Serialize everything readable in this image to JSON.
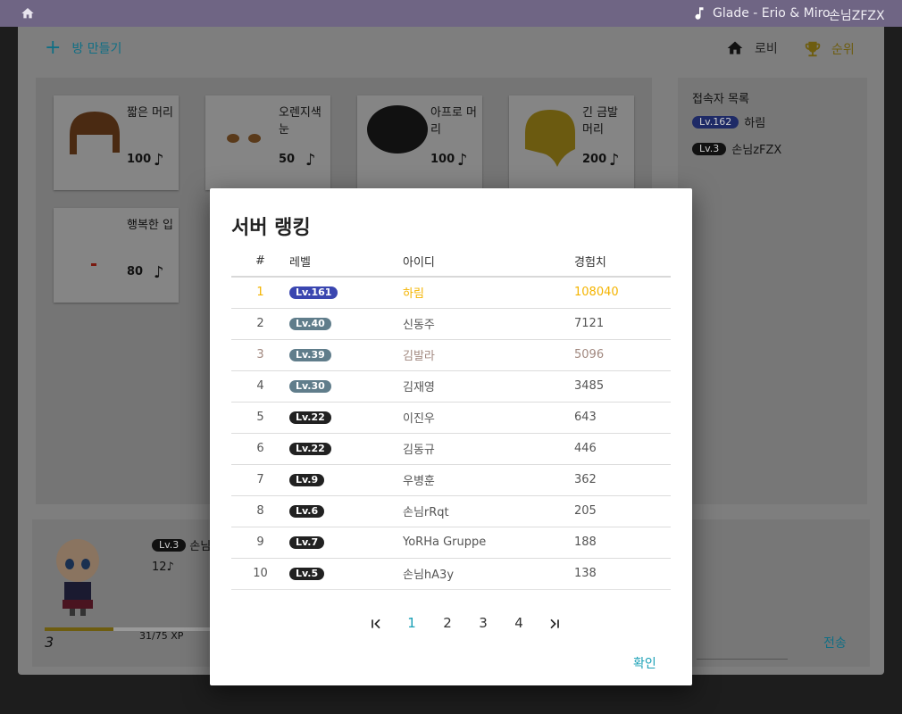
{
  "topbar": {
    "now_playing": "Glade - Erio & Miro",
    "username": "손님ZFZX"
  },
  "toolbar": {
    "new_room": "방 만들기",
    "lobby": "로비",
    "ranking": "순위"
  },
  "shop": {
    "items": [
      {
        "name": "짧은 머리",
        "price": "100"
      },
      {
        "name": "오렌지색 눈",
        "price": "50"
      },
      {
        "name": "아프로 머리",
        "price": "100"
      },
      {
        "name": "긴 금발 머리",
        "price": "200"
      },
      {
        "name": "행복한 입",
        "price": "80"
      }
    ]
  },
  "online": {
    "title": "접속자 목록",
    "users": [
      {
        "level": "Lv.162",
        "name": "하림"
      },
      {
        "level": "Lv.3",
        "name": "손님zFZX"
      }
    ]
  },
  "profile": {
    "level_badge": "Lv.3",
    "name": "손님",
    "notes": "12",
    "level": "3",
    "xp_text": "31/75 XP",
    "xp_progress": 0.413
  },
  "chat": {
    "send": "전송"
  },
  "dialog": {
    "title": "서버 랭킹",
    "columns": {
      "rank": "#",
      "level": "레벨",
      "id": "아이디",
      "xp": "경험치"
    },
    "rows": [
      {
        "rank": "1",
        "level": "Lv.161",
        "id": "하림",
        "xp": "108040",
        "badge_color": "#3a46b0",
        "text_color": "#f4b400"
      },
      {
        "rank": "2",
        "level": "Lv.40",
        "id": "신동주",
        "xp": "7121",
        "badge_color": "#607d8b",
        "text_color": "#555555"
      },
      {
        "rank": "3",
        "level": "Lv.39",
        "id": "김발라",
        "xp": "5096",
        "badge_color": "#607d8b",
        "text_color": "#a1887f"
      },
      {
        "rank": "4",
        "level": "Lv.30",
        "id": "김재영",
        "xp": "3485",
        "badge_color": "#607d8b",
        "text_color": "#555555"
      },
      {
        "rank": "5",
        "level": "Lv.22",
        "id": "이진우",
        "xp": "643",
        "badge_color": "#212121",
        "text_color": "#555555"
      },
      {
        "rank": "6",
        "level": "Lv.22",
        "id": "김동규",
        "xp": "446",
        "badge_color": "#212121",
        "text_color": "#555555"
      },
      {
        "rank": "7",
        "level": "Lv.9",
        "id": "우병훈",
        "xp": "362",
        "badge_color": "#212121",
        "text_color": "#555555"
      },
      {
        "rank": "8",
        "level": "Lv.6",
        "id": "손님rRqt",
        "xp": "205",
        "badge_color": "#212121",
        "text_color": "#555555"
      },
      {
        "rank": "9",
        "level": "Lv.7",
        "id": "YoRHa Gruppe",
        "xp": "188",
        "badge_color": "#212121",
        "text_color": "#555555"
      },
      {
        "rank": "10",
        "level": "Lv.5",
        "id": "손님hA3y",
        "xp": "138",
        "badge_color": "#212121",
        "text_color": "#555555"
      }
    ],
    "pagination": {
      "pages": [
        "1",
        "2",
        "3",
        "4"
      ],
      "current": "1"
    },
    "confirm": "확인"
  },
  "colors": {
    "accent": "#1aa0b6",
    "gold": "#f4b400",
    "topbar": "#6f6584"
  }
}
